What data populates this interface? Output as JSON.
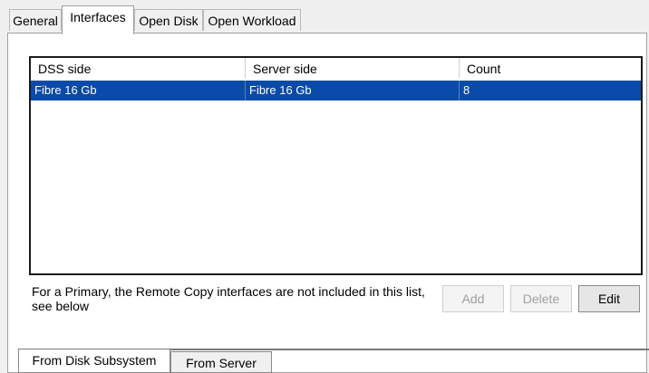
{
  "tabs": [
    "General",
    "Interfaces",
    "Open Disk",
    "Open Workload"
  ],
  "active_tab": "Interfaces",
  "table": {
    "columns": [
      "DSS side",
      "Server side",
      "Count"
    ],
    "rows": [
      {
        "dss_side": "Fibre 16 Gb",
        "server_side": "Fibre 16 Gb",
        "count": "8",
        "selected": true
      }
    ]
  },
  "note": "For a Primary, the Remote Copy interfaces are not included in this list, see below",
  "buttons": {
    "add": "Add",
    "delete": "Delete",
    "edit": "Edit"
  },
  "bottom_tabs": [
    "From Disk Subsystem",
    "From Server"
  ],
  "active_bottom_tab": "From Disk Subsystem",
  "colors": {
    "selection": "#0a4aa8",
    "background": "#f0f0f0",
    "panel": "#ffffff"
  }
}
